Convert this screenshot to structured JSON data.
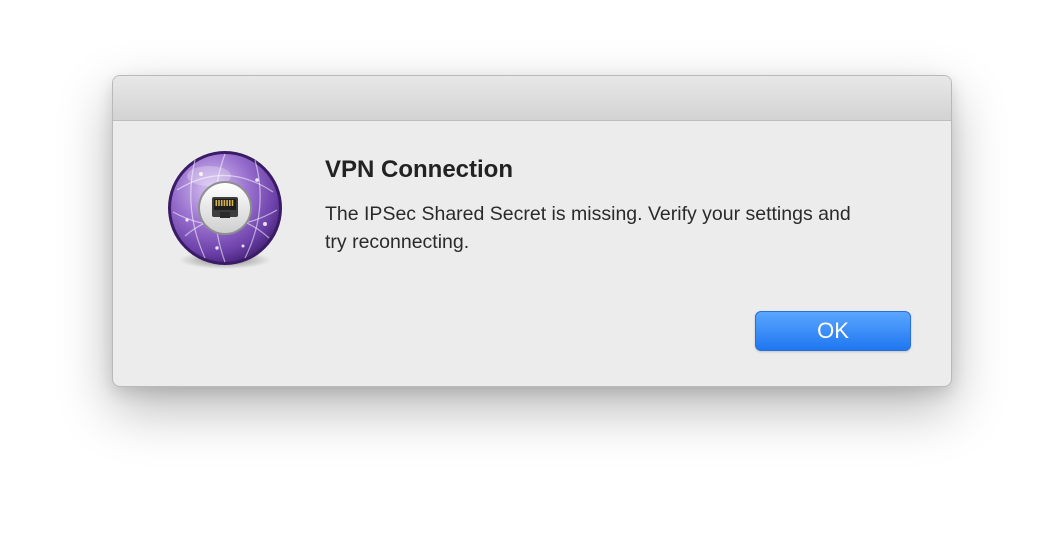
{
  "dialog": {
    "title": "VPN Connection",
    "message": "The IPSec Shared Secret is missing. Verify your settings and try reconnecting.",
    "ok_label": "OK"
  },
  "icon": {
    "name": "vpn-network-globe-icon"
  },
  "colors": {
    "accent_button": "#2f84f8",
    "globe_purple": "#7d55b5"
  }
}
